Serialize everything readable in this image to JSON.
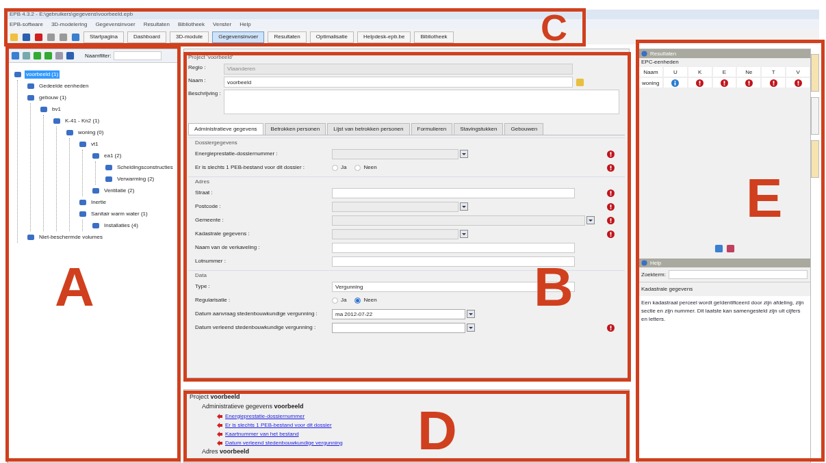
{
  "window": {
    "title": "EPB 4.3.2 - E:\\gebruikers\\gegevens\\voorbeeld.epb"
  },
  "menu": [
    "EPB-software",
    "3D-modelering",
    "Gegevensinvoer",
    "Resultaten",
    "Bibliotheek",
    "Venster",
    "Help"
  ],
  "toolbar": [
    {
      "label": "Startpagina",
      "selected": false
    },
    {
      "label": "Dashboard",
      "selected": false
    },
    {
      "label": "3D-module",
      "selected": false
    },
    {
      "label": "Gegevensinvoer",
      "selected": true
    },
    {
      "label": "Resultaten",
      "selected": false
    },
    {
      "label": "Optimalisatie",
      "selected": false
    },
    {
      "label": "Helpdesk-epb.be",
      "selected": false
    },
    {
      "label": "Bibliotheek",
      "selected": false
    }
  ],
  "tree_panel": {
    "filter_label": "Naamfilter:",
    "nodes": [
      {
        "label": "voorbeeld (1)",
        "selected": true,
        "children": [
          {
            "label": "Gedeelde eenheden",
            "selected": false
          },
          {
            "label": "gebouw (1)",
            "selected": false,
            "children": [
              {
                "label": "bv1",
                "selected": false,
                "children": [
                  {
                    "label": "K-41 - Kn2 (1)",
                    "selected": false,
                    "children": [
                      {
                        "label": "woning (0)",
                        "selected": false,
                        "children": [
                          {
                            "label": "vt1",
                            "selected": false,
                            "children": [
                              {
                                "label": "ea1 (2)",
                                "selected": false,
                                "children": [
                                  {
                                    "label": "Scheidingsconstructies",
                                    "selected": false
                                  },
                                  {
                                    "label": "Verwarming (2)",
                                    "selected": false
                                  }
                                ]
                              },
                              {
                                "label": "Ventilatie (2)",
                                "selected": false
                              }
                            ]
                          },
                          {
                            "label": "Inertie",
                            "selected": false
                          },
                          {
                            "label": "Sanitair warm water (1)",
                            "selected": false,
                            "children": [
                              {
                                "label": "Installaties (4)",
                                "selected": false
                              }
                            ]
                          }
                        ]
                      }
                    ]
                  }
                ]
              }
            ]
          },
          {
            "label": "Niet-beschermde volumes",
            "selected": false
          }
        ]
      }
    ]
  },
  "project": {
    "heading": "Project 'voorbeeld'",
    "fields": [
      {
        "label": "Regio :",
        "value": "Vlaanderen",
        "kind": "select",
        "disabled": true
      },
      {
        "label": "Naam :",
        "value": "voorbeeld",
        "kind": "text"
      },
      {
        "label": "Beschrijving :",
        "kind": "area"
      }
    ],
    "tabs": [
      {
        "label": "Administratieve gegevens",
        "selected": true
      },
      {
        "label": "Betrokken personen",
        "selected": false
      },
      {
        "label": "Lijst van betrokken personen",
        "selected": false
      },
      {
        "label": "Formulieren",
        "selected": false
      },
      {
        "label": "Stavingstukken",
        "selected": false
      },
      {
        "label": "Gebouwen",
        "selected": false
      }
    ],
    "groups": [
      {
        "title": "Dossiergegevens",
        "rows": [
          {
            "label": "Energieprestatie-dossiernummer :",
            "kind": "combo",
            "error": true
          },
          {
            "label": "Er is slechts 1 PEB-bestand voor dit dossier :",
            "kind": "radio",
            "error": true,
            "options": [
              {
                "label": "Ja",
                "selected": false
              },
              {
                "label": "Neen",
                "selected": false
              }
            ]
          }
        ]
      },
      {
        "title": "Adres",
        "rows": [
          {
            "label": "Straat :",
            "kind": "text",
            "error": true
          },
          {
            "label": "Postcode :",
            "kind": "combo",
            "error": true
          },
          {
            "label": "Gemeente :",
            "kind": "widecombo",
            "error": true
          },
          {
            "label": "Kadastrale gegevens :",
            "kind": "combo",
            "error": true
          },
          {
            "label": "Naam van de verkaveling :",
            "kind": "text",
            "error": false
          },
          {
            "label": "Lotnummer :",
            "kind": "text",
            "error": false
          }
        ]
      },
      {
        "title": "Data",
        "rows": [
          {
            "label": "Type :",
            "kind": "text",
            "value": "Vergunning",
            "error": false
          },
          {
            "label": "Regularisatie :",
            "kind": "radio",
            "error": false,
            "options": [
              {
                "label": "Ja",
                "selected": false
              },
              {
                "label": "Neen",
                "selected": true
              }
            ]
          },
          {
            "label": "Datum aanvraag stedenbouwkundige vergunning :",
            "kind": "date",
            "value": "ma 2012-07-22",
            "error": false
          },
          {
            "label": "Datum verleend stedenbouwkundige vergunning :",
            "kind": "date",
            "error": true
          }
        ]
      }
    ]
  },
  "messages": [
    {
      "text": "Project **voorbeeld**",
      "kind": "heading"
    },
    {
      "text": "Administratieve gegevens **voorbeeld**",
      "kind": "section"
    },
    {
      "text": "Energieprestatie-dossiernummer",
      "kind": "link"
    },
    {
      "text": "Er is slechts 1 PEB-bestand voor dit dossier",
      "kind": "link"
    },
    {
      "text": "Kaartnummer van het bestand",
      "kind": "link"
    },
    {
      "text": "Datum verleend stedenbouwkundige vergunning",
      "kind": "link"
    },
    {
      "text": "Adres **voorbeeld**",
      "kind": "section"
    }
  ],
  "results": {
    "title": "Resultaten",
    "subtitle": "EPC-eenheden",
    "columns": [
      "Naam",
      "U",
      "K",
      "E",
      "Ne",
      "T",
      "V"
    ],
    "rows": [
      {
        "name": "woning",
        "cells": [
          {
            "kind": "info"
          },
          {
            "kind": "error"
          },
          {
            "kind": "error"
          },
          {
            "kind": "error"
          },
          {
            "kind": "error"
          },
          {
            "kind": "error"
          }
        ]
      }
    ]
  },
  "help": {
    "title": "Help",
    "search_label": "Zoekterm:",
    "topic": "Kadastrale gegevens",
    "body": "Een kadastraal perceel wordt geïdentificeerd door zijn afdeling, zijn sectie en zijn nummer. Dit laatste kan samengesteld zijn uit cijfers en letters."
  },
  "side_tabs": [
    {
      "selected": true
    },
    {
      "selected": false
    },
    {
      "selected": true
    }
  ],
  "annotations": [
    {
      "label": "A"
    },
    {
      "label": "B"
    },
    {
      "label": "C"
    },
    {
      "label": "D"
    },
    {
      "label": "E"
    }
  ]
}
